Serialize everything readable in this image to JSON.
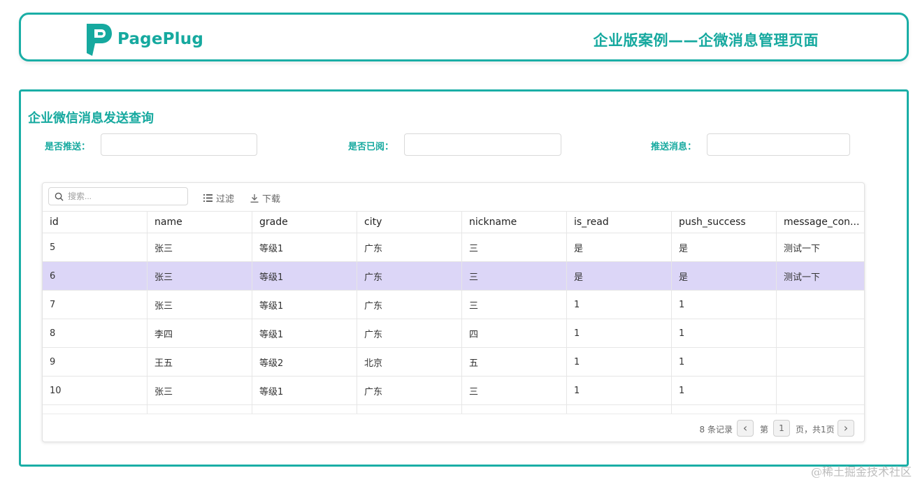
{
  "header": {
    "logo_text": "PagePlug",
    "title": "企业版案例——企微消息管理页面"
  },
  "panel": {
    "title": "企业微信消息发送查询",
    "filters": [
      {
        "label": "是否推送：",
        "value": "",
        "placeholder": ""
      },
      {
        "label": "是否已阅：",
        "value": "",
        "placeholder": ""
      },
      {
        "label": "推送消息：",
        "value": "",
        "placeholder": ""
      }
    ]
  },
  "toolbar": {
    "search_placeholder": "搜索...",
    "filter_label": "过滤",
    "download_label": "下载"
  },
  "table": {
    "columns": [
      "id",
      "name",
      "grade",
      "city",
      "nickname",
      "is_read",
      "push_success",
      "message_con..."
    ],
    "rows": [
      [
        "5",
        "张三",
        "等级1",
        "广东",
        "三",
        "是",
        "是",
        "测试一下"
      ],
      [
        "6",
        "张三",
        "等级1",
        "广东",
        "三",
        "是",
        "是",
        "测试一下"
      ],
      [
        "7",
        "张三",
        "等级1",
        "广东",
        "三",
        "1",
        "1",
        ""
      ],
      [
        "8",
        "李四",
        "等级1",
        "广东",
        "四",
        "1",
        "1",
        ""
      ],
      [
        "9",
        "王五",
        "等级2",
        "北京",
        "五",
        "1",
        "1",
        ""
      ],
      [
        "10",
        "张三",
        "等级1",
        "广东",
        "三",
        "1",
        "1",
        ""
      ]
    ],
    "selected_row_index": 1
  },
  "pagination": {
    "record_count": "8 条记录",
    "page_prefix": "第",
    "current_page": "1",
    "page_suffix": "页，共1页",
    "prev_symbol": "‹",
    "next_symbol": "›"
  },
  "watermark": "@稀土掘金技术社区",
  "colors": {
    "accent": "#16a99f",
    "selected_row": "#dcd6f7"
  }
}
